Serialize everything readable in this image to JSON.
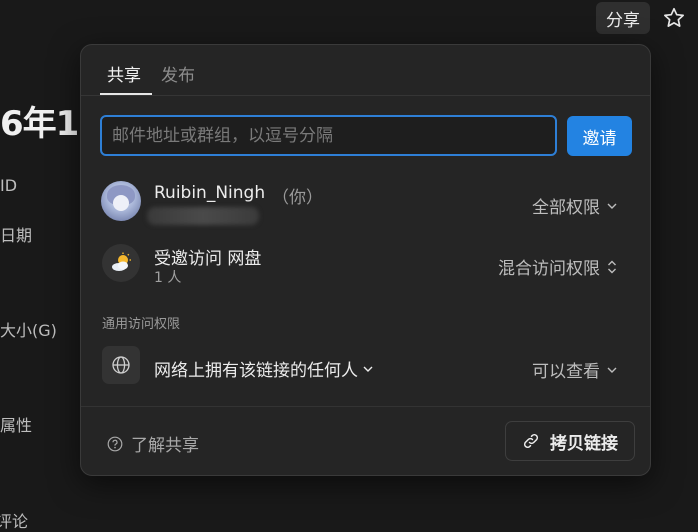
{
  "background": {
    "title_fragment": "6年1.",
    "props": [
      "ID",
      "日期",
      "大小(G)",
      "属性",
      "评论"
    ]
  },
  "header": {
    "share_label": "分享",
    "star_icon": "star-icon"
  },
  "share_popover": {
    "tabs": [
      {
        "label": "共享",
        "active": true
      },
      {
        "label": "发布",
        "active": false
      }
    ],
    "invite": {
      "placeholder": "邮件地址或群组，以逗号分隔",
      "button_label": "邀请"
    },
    "members": [
      {
        "name": "Ruibin_Ningh",
        "suffix": "（你）",
        "email": "",
        "permission": "全部权限"
      },
      {
        "name": "受邀访问 网盘",
        "count": "1 人",
        "permission": "混合访问权限"
      }
    ],
    "general": {
      "section_label": "通用访问权限",
      "access_label": "网络上拥有该链接的任何人",
      "permission": "可以查看"
    },
    "footer": {
      "learn_label": "了解共享",
      "copy_link_label": "拷贝链接"
    }
  },
  "colors": {
    "accent": "#2383e2",
    "background": "#191919",
    "popover": "#252525"
  }
}
